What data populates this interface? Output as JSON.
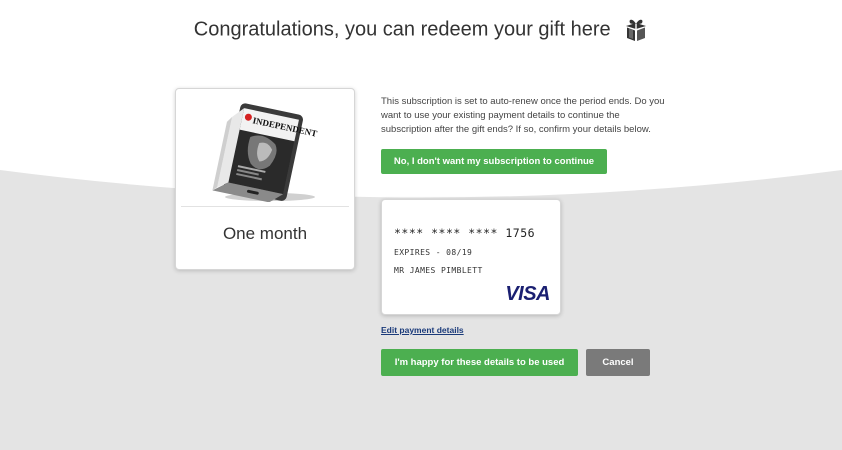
{
  "page": {
    "title": "Congratulations, you can redeem your gift here",
    "title_icon": "gift-icon"
  },
  "product": {
    "image": "magazine-tablet-image",
    "masthead": "INDEPENDENT",
    "duration": "One month"
  },
  "renewal": {
    "notice": "This subscription is set to auto-renew once the period ends. Do you want to use your existing payment details to continue the subscription after the gift ends? If so, confirm your details below.",
    "decline_label": "No, I don't want my subscription to continue"
  },
  "payment_card": {
    "number": "**** **** **** 1756",
    "expiry": "EXPIRES - 08/19",
    "holder": "MR JAMES PIMBLETT",
    "brand": "VISA",
    "brand_color": "#1a1f71"
  },
  "actions": {
    "edit_label": "Edit payment details",
    "confirm_label": "I'm happy for these details to be used",
    "cancel_label": "Cancel"
  },
  "colors": {
    "accent_green": "#4caf50",
    "cancel_gray": "#7a7a7a",
    "background_gray": "#e4e4e4"
  }
}
